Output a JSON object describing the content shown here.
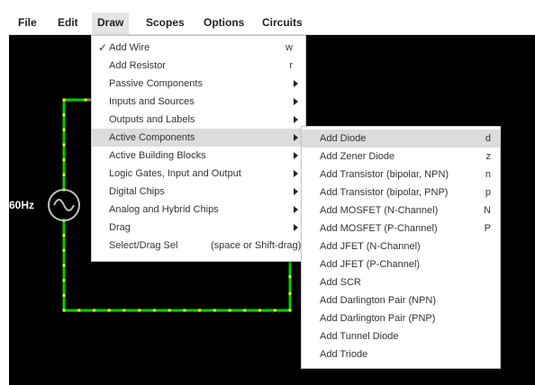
{
  "menubar": {
    "items": [
      {
        "label": "File"
      },
      {
        "label": "Edit"
      },
      {
        "label": "Draw"
      },
      {
        "label": "Scopes"
      },
      {
        "label": "Options"
      },
      {
        "label": "Circuits"
      }
    ]
  },
  "canvas": {
    "source_label": "60Hz",
    "wire_color": "#00cc00",
    "node_color": "#ffff00",
    "idle_wire_color": "#808080"
  },
  "draw_menu": {
    "items": [
      {
        "label": "Add Wire",
        "shortcut": "w",
        "checked": true
      },
      {
        "label": "Add Resistor",
        "shortcut": "r"
      },
      {
        "label": "Passive Components"
      },
      {
        "label": "Inputs and Sources"
      },
      {
        "label": "Outputs and Labels"
      },
      {
        "label": "Active Components"
      },
      {
        "label": "Active Building Blocks"
      },
      {
        "label": "Logic Gates, Input and Output"
      },
      {
        "label": "Digital Chips"
      },
      {
        "label": "Analog and Hybrid Chips"
      },
      {
        "label": "Drag"
      },
      {
        "label": "Select/Drag Sel",
        "shortcut": "(space or Shift-drag)"
      }
    ],
    "check_mark": "✓"
  },
  "active_components_menu": {
    "items": [
      {
        "label": "Add Diode",
        "shortcut": "d"
      },
      {
        "label": "Add Zener Diode",
        "shortcut": "z"
      },
      {
        "label": "Add Transistor (bipolar, NPN)",
        "shortcut": "n"
      },
      {
        "label": "Add Transistor (bipolar, PNP)",
        "shortcut": "p"
      },
      {
        "label": "Add MOSFET (N-Channel)",
        "shortcut": "N"
      },
      {
        "label": "Add MOSFET (P-Channel)",
        "shortcut": "P"
      },
      {
        "label": "Add JFET (N-Channel)"
      },
      {
        "label": "Add JFET (P-Channel)"
      },
      {
        "label": "Add SCR"
      },
      {
        "label": "Add Darlington Pair (NPN)"
      },
      {
        "label": "Add Darlington Pair (PNP)"
      },
      {
        "label": "Add Tunnel Diode"
      },
      {
        "label": "Add Triode"
      }
    ]
  }
}
